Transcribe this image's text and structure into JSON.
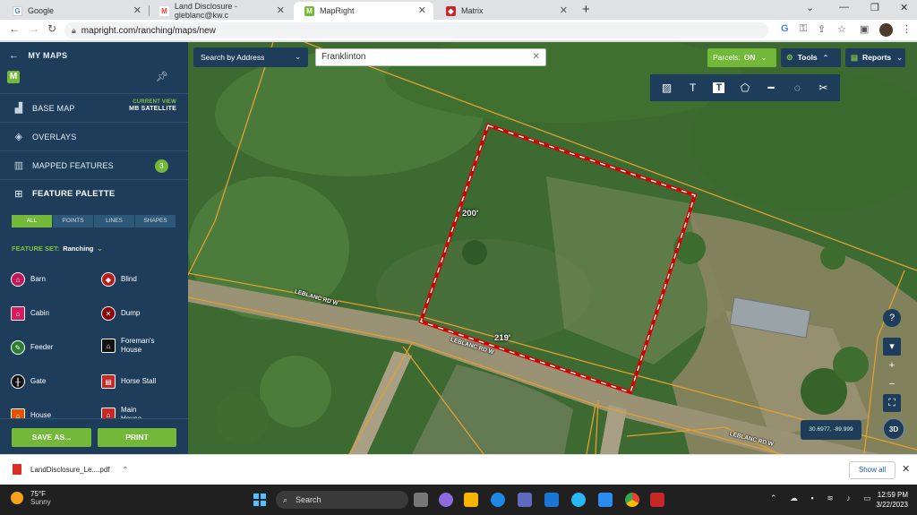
{
  "browser": {
    "tabs": [
      {
        "title": "Google",
        "favicon": "G",
        "color": "#4285f4"
      },
      {
        "title": "Land Disclosure - gleblanc@kw.c",
        "favicon": "M",
        "color": "#ea4335"
      },
      {
        "title": "MapRight",
        "favicon": "M",
        "color": "#74b83a"
      },
      {
        "title": "Matrix",
        "favicon": "◆",
        "color": "#c62828"
      }
    ],
    "url": "mapright.com/ranching/maps/new"
  },
  "sidebar": {
    "header": "MY MAPS",
    "rows": {
      "base_map": "BASE MAP",
      "current_view_label": "CURRENT VIEW",
      "current_view_value": "MB SATELLITE",
      "overlays": "OVERLAYS",
      "mapped_features": "MAPPED FEATURES",
      "mapped_count": "3",
      "feature_palette": "FEATURE PALETTE"
    },
    "filter_tabs": [
      "ALL",
      "POINTS",
      "LINES",
      "SHAPES"
    ],
    "feature_set_label": "FEATURE SET:",
    "feature_set_value": "Ranching",
    "features": [
      {
        "label": "Barn",
        "color": "#c2185b"
      },
      {
        "label": "Blind",
        "color": "#b71c1c"
      },
      {
        "label": "Cabin",
        "color": "#d81b60"
      },
      {
        "label": "Dump",
        "color": "#8b0000"
      },
      {
        "label": "Feeder",
        "color": "#2e7d32"
      },
      {
        "label": "Foreman's House",
        "color": "#111111"
      },
      {
        "label": "Gate",
        "color": "#111111"
      },
      {
        "label": "Horse Stall",
        "color": "#c62828"
      },
      {
        "label": "House",
        "color": "#e65100"
      },
      {
        "label": "Main House",
        "color": "#c62828"
      }
    ],
    "save_label": "SAVE AS...",
    "print_label": "PRINT"
  },
  "map": {
    "search_type": "Search by Address",
    "search_value": "Franklinton",
    "parcels_label": "Parcels:",
    "parcels_value": "ON",
    "tools_label": "Tools",
    "reports_label": "Reports",
    "dim_top": "200'",
    "dim_bottom": "219'",
    "road_labels": [
      "LEBLANC RD W",
      "LEBLANC RD W",
      "LEBLANC RD W"
    ],
    "coords": "30.6977, -89.999",
    "btn_3d": "3D",
    "boundary_color": "#d40000",
    "parcel_line_color": "#e0a030"
  },
  "downloads": {
    "file": "LandDisclosure_Le....pdf",
    "show_all": "Show all"
  },
  "taskbar": {
    "temp": "75°F",
    "condition": "Sunny",
    "search": "Search",
    "time": "12:59 PM",
    "date": "3/22/2023"
  }
}
